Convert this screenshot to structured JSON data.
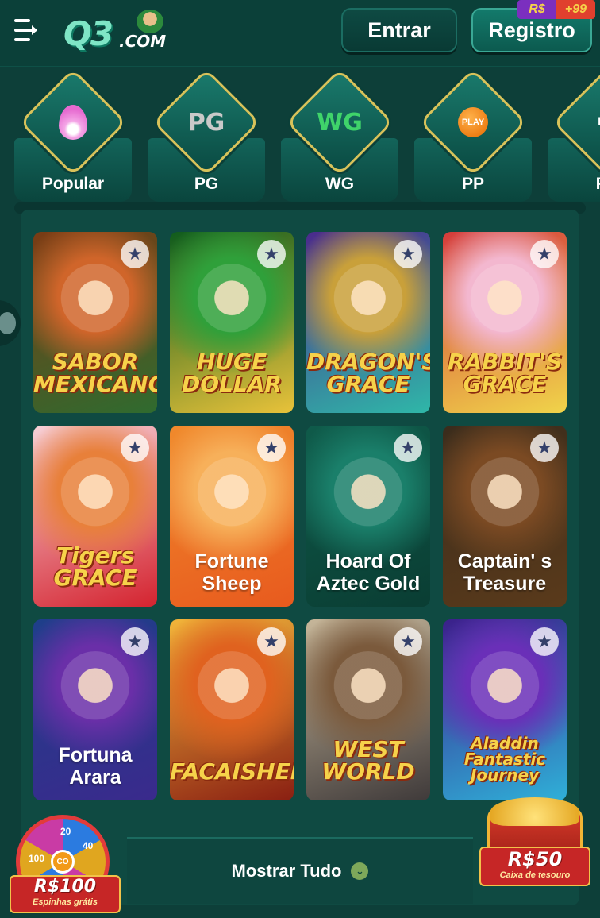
{
  "header": {
    "logo_main": "Q3",
    "logo_suffix": ".COM",
    "login_label": "Entrar",
    "register_label": "Registro",
    "register_badge_currency": "R$",
    "register_badge_value": "+99"
  },
  "categories": [
    {
      "label": "Popular",
      "icon": "flame-icon"
    },
    {
      "label": "PG",
      "icon": "pg-logo"
    },
    {
      "label": "WG",
      "icon": "wg-logo"
    },
    {
      "label": "PP",
      "icon": "pp-coin-icon",
      "icon_text": "PLAY"
    },
    {
      "label": "Po",
      "icon": "po-logo",
      "icon_text": "PO"
    }
  ],
  "games": [
    {
      "title": "",
      "art_text": "SABOR MEXICANO",
      "colors": [
        "#7a3b14",
        "#d0652a",
        "#2f6b2f"
      ]
    },
    {
      "title": "",
      "art_text": "HUGE DOLLAR",
      "colors": [
        "#0f5b1d",
        "#2fa03a",
        "#e8c23a"
      ]
    },
    {
      "title": "",
      "art_text": "DRAGON'S GRACE",
      "colors": [
        "#4b2a8c",
        "#c9a03a",
        "#2fb7a8"
      ]
    },
    {
      "title": "",
      "art_text": "RABBIT'S GRACE",
      "colors": [
        "#d43b3b",
        "#f3b7cf",
        "#f0d44a"
      ]
    },
    {
      "title": "",
      "art_text": "Tigers GRACE",
      "colors": [
        "#f7d2d8",
        "#e8803a",
        "#d4232f"
      ]
    },
    {
      "title": "Fortune Sheep",
      "art_text": "",
      "colors": [
        "#f08a2c",
        "#f7b05a",
        "#e85a1e"
      ]
    },
    {
      "title": "Hoard Of Aztec Gold",
      "art_text": "",
      "colors": [
        "#0f5b4a",
        "#1a7f6a",
        "#0a3d33"
      ]
    },
    {
      "title": "Captain' s Treasure",
      "art_text": "",
      "colors": [
        "#3a2c1c",
        "#7b4a23",
        "#5a3a1b"
      ]
    },
    {
      "title": "Fortuna Arara",
      "art_text": "",
      "colors": [
        "#1e3f8a",
        "#6a2fa8",
        "#3a2a8c"
      ]
    },
    {
      "title": "",
      "art_text": "FACAISHEN",
      "colors": [
        "#f2b53a",
        "#e0621f",
        "#8a1f12"
      ]
    },
    {
      "title": "",
      "art_text": "WEST WORLD",
      "colors": [
        "#c7b79a",
        "#7b5a3c",
        "#3f3a3a"
      ]
    },
    {
      "title": "",
      "art_text": "Aladdin Fantastic Journey",
      "colors": [
        "#3b1f8a",
        "#6a2fb8",
        "#2fb0d8"
      ]
    }
  ],
  "show_all": {
    "label": "Mostrar Tudo"
  },
  "promo_wheel": {
    "amount": "R$100",
    "subtitle": "Espinhas grátis",
    "numbers": [
      "20",
      "40",
      "100"
    ],
    "hub_text": "CO"
  },
  "promo_chest": {
    "amount": "R$50",
    "subtitle": "Caixa de tesouro"
  },
  "colors": {
    "accent": "#3aa895",
    "background": "#0d3f39",
    "gold": "#d8c25a"
  }
}
